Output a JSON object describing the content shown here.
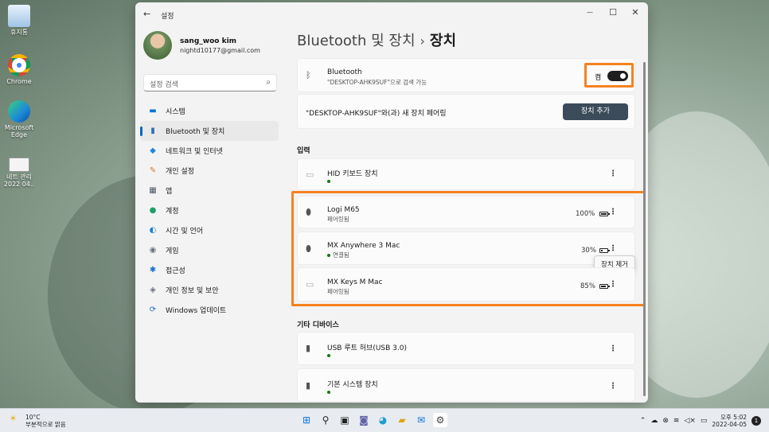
{
  "desktop": {
    "icons": [
      {
        "label": "휴지통",
        "icon": "recycle-bin-icon"
      },
      {
        "label": "Chrome",
        "icon": "chrome-icon"
      },
      {
        "label": "Microsoft Edge",
        "icon": "edge-icon"
      },
      {
        "label": "네트 관리 2022 04..",
        "icon": "file-icon"
      }
    ]
  },
  "window": {
    "back_glyph": "←",
    "title": "설정",
    "minimize": "—",
    "maximize": "☐",
    "close": "✕"
  },
  "profile": {
    "name": "sang_woo kim",
    "email": "nightd10177@gmail.com"
  },
  "search": {
    "placeholder": "설정 검색",
    "icon": "search-icon"
  },
  "nav": {
    "items": [
      {
        "label": "시스템",
        "icon": "system-icon",
        "glyph": "▬",
        "color": "#0a74d6"
      },
      {
        "label": "Bluetooth 및 장치",
        "icon": "bluetooth-devices-icon",
        "glyph": "▮",
        "color": "#2d6fb8",
        "active": true
      },
      {
        "label": "네트워크 및 인터넷",
        "icon": "network-icon",
        "glyph": "◆",
        "color": "#1f88d9"
      },
      {
        "label": "개인 설정",
        "icon": "personalization-icon",
        "glyph": "✎",
        "color": "#d8782b"
      },
      {
        "label": "앱",
        "icon": "apps-icon",
        "glyph": "▦",
        "color": "#4a5563"
      },
      {
        "label": "계정",
        "icon": "accounts-icon",
        "glyph": "●",
        "color": "#1e9e6a"
      },
      {
        "label": "시간 및 언어",
        "icon": "time-language-icon",
        "glyph": "◐",
        "color": "#1b7fd1"
      },
      {
        "label": "게임",
        "icon": "gaming-icon",
        "glyph": "◉",
        "color": "#6b7280"
      },
      {
        "label": "접근성",
        "icon": "accessibility-icon",
        "glyph": "✱",
        "color": "#1b6fd1"
      },
      {
        "label": "개인 정보 및 보안",
        "icon": "privacy-shield-icon",
        "glyph": "◈",
        "color": "#6b7280"
      },
      {
        "label": "Windows 업데이트",
        "icon": "windows-update-icon",
        "glyph": "⟳",
        "color": "#1b6fd1"
      }
    ]
  },
  "main": {
    "breadcrumb_parent": "Bluetooth 및 장치",
    "breadcrumb_sep": "›",
    "breadcrumb_leaf": "장치",
    "bluetooth_card": {
      "title": "Bluetooth",
      "subtitle": "\"DESKTOP-AHK9SUF\"으로 검색 가능",
      "toggle_label": "켬",
      "toggle_on": true
    },
    "pair_card": {
      "text": "\"DESKTOP-AHK9SUF\"와(과) 새 장치 페어링",
      "button": "장치 추가"
    },
    "input_section": "입력",
    "input_devices": [
      {
        "name": "HID 키보드 장치",
        "status": "",
        "connected_dot": true,
        "battery": null,
        "icon": "keyboard-icon"
      },
      {
        "name": "Logi M65",
        "status": "페어링됨",
        "connected_dot": false,
        "battery": "100%",
        "battery_level": 1.0,
        "icon": "mouse-icon"
      },
      {
        "name": "MX Anywhere 3 Mac",
        "status": "연결됨",
        "connected_dot": true,
        "battery": "30%",
        "battery_level": 0.3,
        "icon": "mouse-icon"
      },
      {
        "name": "MX Keys M Mac",
        "status": "페어링됨",
        "connected_dot": false,
        "battery": "85%",
        "battery_level": 0.85,
        "icon": "keyboard-icon"
      }
    ],
    "tooltip": "장치 제거",
    "other_section": "기타 디바이스",
    "other_devices": [
      {
        "name": "USB 루트 허브(USB 3.0)",
        "connected_dot": true,
        "icon": "usb-hub-icon"
      },
      {
        "name": "기본 시스템 장치",
        "connected_dot": true,
        "icon": "system-device-icon"
      }
    ],
    "more_glyph": "⋮"
  },
  "taskbar": {
    "weather_temp": "10°C",
    "weather_desc": "부분적으로 맑음",
    "apps": [
      {
        "icon": "windows-start-icon",
        "glyph": "⊞",
        "color": "#0a74d6"
      },
      {
        "icon": "search-icon",
        "glyph": "⚲",
        "color": "#222222"
      },
      {
        "icon": "task-view-icon",
        "glyph": "▣",
        "color": "#222222"
      },
      {
        "icon": "teams-chat-icon",
        "glyph": "◙",
        "color": "#6264a7"
      },
      {
        "icon": "edge-icon",
        "glyph": "◕",
        "color": "#1fa0cc"
      },
      {
        "icon": "file-explorer-icon",
        "glyph": "▰",
        "color": "#e3a21a"
      },
      {
        "icon": "mail-icon",
        "glyph": "✉",
        "color": "#0a74d6"
      },
      {
        "icon": "settings-gear-icon",
        "glyph": "⚙",
        "color": "#444444",
        "active": true
      }
    ],
    "tray_glyphs": [
      "⌃",
      "☁",
      "⊗",
      "≋",
      "◁×",
      "▭"
    ],
    "time": "오후 5:02",
    "date": "2022-04-05",
    "notifications": "1"
  }
}
